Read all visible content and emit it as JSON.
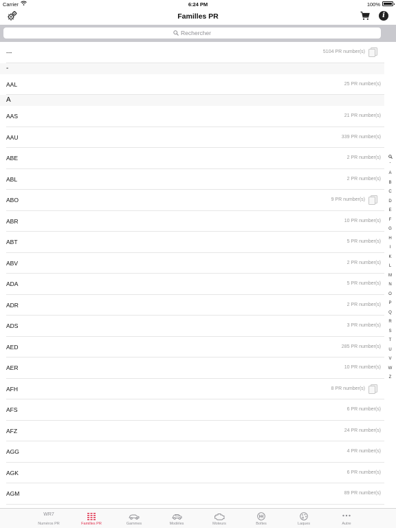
{
  "status": {
    "carrier": "Carrier",
    "time": "6:24 PM",
    "battery": "100%"
  },
  "nav": {
    "title": "Familles PR"
  },
  "search": {
    "placeholder": "Rechercher"
  },
  "rows": [
    {
      "type": "item",
      "code": "---",
      "count": "5104 PR number(s)",
      "icon": true
    },
    {
      "type": "section",
      "title": "-"
    },
    {
      "type": "item",
      "code": "AAL",
      "count": "25 PR number(s)"
    },
    {
      "type": "section",
      "title": "A"
    },
    {
      "type": "item",
      "code": "AAS",
      "count": "21 PR number(s)"
    },
    {
      "type": "item",
      "code": "AAU",
      "count": "339 PR number(s)"
    },
    {
      "type": "item",
      "code": "ABE",
      "count": "2 PR number(s)"
    },
    {
      "type": "item",
      "code": "ABL",
      "count": "2 PR number(s)"
    },
    {
      "type": "item",
      "code": "ABO",
      "count": "9 PR number(s)",
      "icon": true
    },
    {
      "type": "item",
      "code": "ABR",
      "count": "10 PR number(s)"
    },
    {
      "type": "item",
      "code": "ABT",
      "count": "5 PR number(s)"
    },
    {
      "type": "item",
      "code": "ABV",
      "count": "2 PR number(s)"
    },
    {
      "type": "item",
      "code": "ADA",
      "count": "5 PR number(s)"
    },
    {
      "type": "item",
      "code": "ADR",
      "count": "2 PR number(s)"
    },
    {
      "type": "item",
      "code": "ADS",
      "count": "3 PR number(s)"
    },
    {
      "type": "item",
      "code": "AED",
      "count": "285 PR number(s)"
    },
    {
      "type": "item",
      "code": "AER",
      "count": "10 PR number(s)"
    },
    {
      "type": "item",
      "code": "AFH",
      "count": "8 PR number(s)",
      "icon": true
    },
    {
      "type": "item",
      "code": "AFS",
      "count": "6 PR number(s)"
    },
    {
      "type": "item",
      "code": "AFZ",
      "count": "24 PR number(s)"
    },
    {
      "type": "item",
      "code": "AGG",
      "count": "4 PR number(s)"
    },
    {
      "type": "item",
      "code": "AGK",
      "count": "6 PR number(s)"
    },
    {
      "type": "item",
      "code": "AGM",
      "count": "89 PR number(s)"
    }
  ],
  "index": [
    "-",
    "A",
    "B",
    "C",
    "D",
    "E",
    "F",
    "G",
    "H",
    "I",
    "K",
    "L",
    "M",
    "N",
    "O",
    "P",
    "Q",
    "R",
    "S",
    "T",
    "U",
    "V",
    "W",
    "Z"
  ],
  "tabs": [
    {
      "label": "Numéros PR",
      "icon": "wr7-text-icon",
      "text": "WR7"
    },
    {
      "label": "Familles PR",
      "icon": "grid-icon",
      "active": true
    },
    {
      "label": "Gammes",
      "icon": "car-icon"
    },
    {
      "label": "Modèles",
      "icon": "car-front-icon"
    },
    {
      "label": "Moteurs",
      "icon": "engine-icon"
    },
    {
      "label": "Boîtes",
      "icon": "gearbox-icon"
    },
    {
      "label": "Laques",
      "icon": "palette-icon"
    },
    {
      "label": "Autre",
      "icon": "more-icon"
    }
  ],
  "colors": {
    "accent": "#e0334f",
    "search_bg": "#c9c9ce",
    "section_bg": "#f7f7f7"
  }
}
